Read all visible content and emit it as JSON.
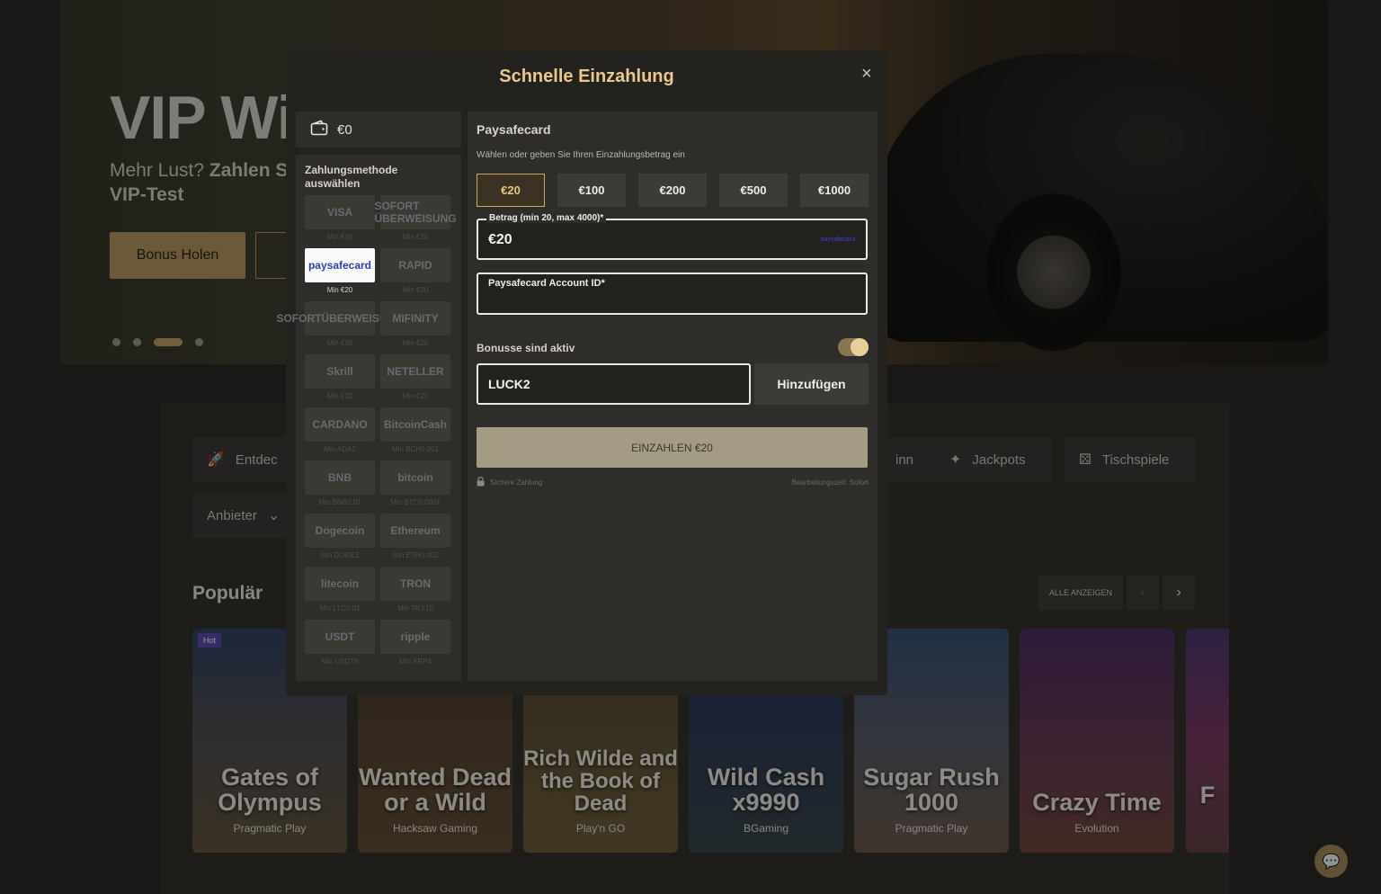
{
  "hero": {
    "title": "VIP Wi",
    "subtitle_plain": "Mehr Lust? ",
    "subtitle_bold": "Zahlen Si",
    "subtitle_line2": "VIP-Test",
    "cta": "Bonus Holen"
  },
  "tabs": {
    "discover": "Entdec",
    "jackpots": "Jackpots",
    "table_games": "Tischspiele",
    "win_fragment": "inn",
    "provider": "Anbieter"
  },
  "popular": {
    "title": "Populär",
    "show_all": "ALLE ANZEIGEN"
  },
  "games": [
    {
      "title": "Gates of Olympus",
      "provider": "Pragmatic Play",
      "badge": "Hot"
    },
    {
      "title": "Wanted Dead or a Wild",
      "provider": "Hacksaw Gaming"
    },
    {
      "title": "Rich Wilde and the Book of Dead",
      "provider": "Play'n GO"
    },
    {
      "title": "Wild Cash x9990",
      "provider": "BGaming"
    },
    {
      "title": "Sugar Rush 1000",
      "provider": "Pragmatic Play"
    },
    {
      "title": "Crazy Time",
      "provider": "Evolution"
    },
    {
      "title": "F",
      "provider": ""
    }
  ],
  "modal": {
    "title": "Schnelle Einzahlung",
    "close": "×",
    "balance": "€0",
    "methods_title": "Zahlungsmethode auswählen",
    "methods": [
      {
        "name": "VISA",
        "min": "Min €20"
      },
      {
        "name": "SOFORT ÜBERWEISUNG",
        "min": "Min €20"
      },
      {
        "name": "paysafecard",
        "min": "Min €20",
        "selected": true
      },
      {
        "name": "RAPID",
        "min": "Min €20"
      },
      {
        "name": "SOFORTÜBERWEISUNG",
        "min": "Min €20"
      },
      {
        "name": "MIFINITY",
        "min": "Min €20"
      },
      {
        "name": "Skrill",
        "min": "Min €20"
      },
      {
        "name": "NETELLER",
        "min": "Min €20"
      },
      {
        "name": "CARDANO",
        "min": "Min ADA2"
      },
      {
        "name": "BitcoinCash",
        "min": "Min BCH0.001"
      },
      {
        "name": "BNB",
        "min": "Min BNB0.01"
      },
      {
        "name": "bitcoin",
        "min": "Min BTC0.0001"
      },
      {
        "name": "Dogecoin",
        "min": "Min DOGE1"
      },
      {
        "name": "Ethereum",
        "min": "Min ETH0.002"
      },
      {
        "name": "litecoin",
        "min": "Min LTC0.01"
      },
      {
        "name": "TRON",
        "min": "Min TRX10"
      },
      {
        "name": "USDT",
        "min": "Min USDT5"
      },
      {
        "name": "ripple",
        "min": "Min XRP4"
      }
    ],
    "payment_name": "Paysafecard",
    "hint": "Wählen oder geben Sie Ihren Einzahlungsbetrag ein",
    "amounts": [
      "€20",
      "€100",
      "€200",
      "€500",
      "€1000"
    ],
    "amount_label": "Betrag (min 20, max 4000)*",
    "amount_value": "€20",
    "amount_logo": "paysafecard",
    "account_label": "Paysafecard Account ID*",
    "bonus_label": "Bonusse sind aktiv",
    "promo_code": "LUCK2",
    "promo_button": "Hinzufügen",
    "deposit_button": "EINZAHLEN €20",
    "secure": "Sichere Zahlung",
    "processing": "Bearbeitungszeit: Sofort"
  },
  "colors": {
    "accent": "#c2a46b",
    "gold_title": "#e9c98a"
  }
}
